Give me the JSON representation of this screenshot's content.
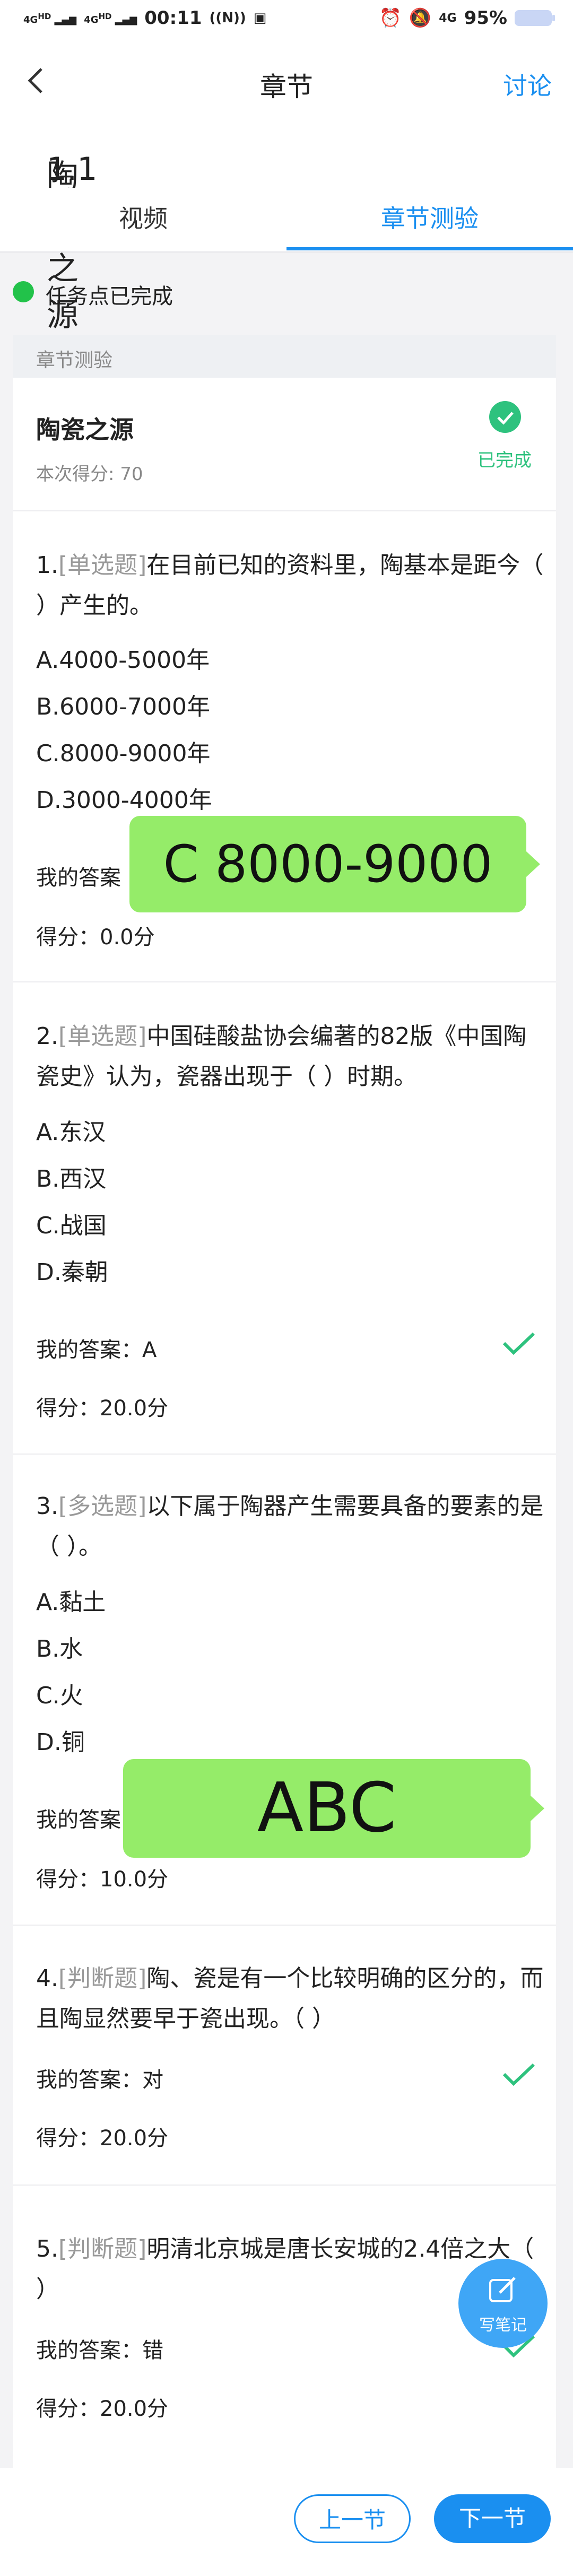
{
  "status_bar": {
    "signal1": "4G",
    "signal1_sub": "HD",
    "signal2": "4G",
    "signal2_sub": "HD",
    "time": "00:11",
    "battery": "95%",
    "net": "4G"
  },
  "nav": {
    "title": "章节",
    "discuss": "讨论"
  },
  "section": {
    "number": "1.1",
    "title": "陶瓷之源"
  },
  "tabs": [
    "视频",
    "章节测验"
  ],
  "task": "任务点已完成",
  "card": {
    "header": "章节测验",
    "title": "陶瓷之源",
    "score": "本次得分: 70",
    "status": "已完成"
  },
  "questions": [
    {
      "num": "1.",
      "type": "[单选题]",
      "text": "在目前已知的资料里，陶基本是距今（ ）产生的。",
      "options": [
        "A.4000-5000年",
        "B.6000-7000年",
        "C.8000-9000年",
        "D.3000-4000年"
      ],
      "answer_label": "我的答案",
      "answer": "",
      "score": "得分：0.0分"
    },
    {
      "num": "2.",
      "type": "[单选题]",
      "text": "中国硅酸盐协会编著的82版《中国陶瓷史》认为，瓷器出现于（ ）时期。",
      "options": [
        "A.东汉",
        "B.西汉",
        "C.战国",
        "D.秦朝"
      ],
      "answer_label": "我的答案：A",
      "score": "得分：20.0分"
    },
    {
      "num": "3.",
      "type": "[多选题]",
      "text": "以下属于陶器产生需要具备的要素的是（ ）。",
      "options": [
        "A.黏土",
        "B.水",
        "C.火",
        "D.铜"
      ],
      "answer_label": "我的答案",
      "score": "得分：10.0分"
    },
    {
      "num": "4.",
      "type": "[判断题]",
      "text": "陶、瓷是有一个比较明确的区分的，而且陶显然要早于瓷出现。（ ）",
      "answer_label": "我的答案：对",
      "score": "得分：20.0分"
    },
    {
      "num": "5.",
      "type": "[判断题]",
      "text": "明清北京城是唐长安城的2.4倍之大（ ）",
      "answer_label": "我的答案：错",
      "score": "得分：20.0分"
    }
  ],
  "bubbles": [
    "C 8000-9000",
    "ABC"
  ],
  "note_button": "写笔记",
  "bottom": {
    "prev": "上一节",
    "next": "下一节"
  },
  "colors": {
    "accent": "#1a8ff0",
    "success": "#2ec27e",
    "bubble": "#95ec69"
  }
}
